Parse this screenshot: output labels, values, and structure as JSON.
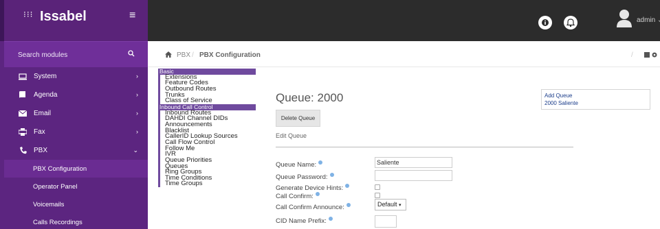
{
  "brand": {
    "name": "Issabel"
  },
  "sidebar": {
    "search_placeholder": "Search modules",
    "items": [
      {
        "label": "System",
        "icon": "monitor-icon"
      },
      {
        "label": "Agenda",
        "icon": "book-icon"
      },
      {
        "label": "Email",
        "icon": "envelope-icon"
      },
      {
        "label": "Fax",
        "icon": "printer-icon"
      },
      {
        "label": "PBX",
        "icon": "phone-icon"
      }
    ],
    "sub_items": [
      {
        "label": "PBX Configuration"
      },
      {
        "label": "Operator Panel"
      },
      {
        "label": "Voicemails"
      },
      {
        "label": "Calls Recordings"
      }
    ]
  },
  "topbar": {
    "user": "admin"
  },
  "breadcrumb": {
    "section": "PBX",
    "page": "PBX Configuration"
  },
  "module_menu": [
    {
      "label": "Basic",
      "kind": "cat"
    },
    {
      "label": "Extensions",
      "kind": "item"
    },
    {
      "label": "Feature Codes",
      "kind": "item"
    },
    {
      "label": "Outbound Routes",
      "kind": "item"
    },
    {
      "label": "Trunks",
      "kind": "item"
    },
    {
      "label": "Class of Service",
      "kind": "item"
    },
    {
      "label": "Inbound Call Control",
      "kind": "cat"
    },
    {
      "label": "Inbound Routes",
      "kind": "item"
    },
    {
      "label": "DAHDI Channel DIDs",
      "kind": "item"
    },
    {
      "label": "Announcements",
      "kind": "item"
    },
    {
      "label": "Blacklist",
      "kind": "item"
    },
    {
      "label": "CallerID Lookup Sources",
      "kind": "item"
    },
    {
      "label": "Call Flow Control",
      "kind": "item"
    },
    {
      "label": "Follow Me",
      "kind": "item"
    },
    {
      "label": "IVR",
      "kind": "item"
    },
    {
      "label": "Queue Priorities",
      "kind": "item"
    },
    {
      "label": "Queues",
      "kind": "item"
    },
    {
      "label": "Ring Groups",
      "kind": "item"
    },
    {
      "label": "Time Conditions",
      "kind": "item"
    },
    {
      "label": "Time Groups",
      "kind": "item"
    }
  ],
  "queue": {
    "title": "Queue: 2000",
    "delete_label": "Delete Queue",
    "edit_label": "Edit Queue"
  },
  "queue_list": {
    "add_label": "Add Queue",
    "entry_label": "2000 Saliente"
  },
  "form": {
    "queue_name_label": "Queue Name:",
    "queue_name_value": "Saliente",
    "queue_password_label": "Queue Password:",
    "queue_password_value": "",
    "gen_hints_label": "Generate Device Hints:",
    "call_confirm_label": "Call Confirm:",
    "call_confirm_announce_label": "Call Confirm Announce:",
    "call_confirm_announce_value": "Default",
    "cid_prefix_label": "CID Name Prefix:"
  },
  "colors": {
    "sidebar": "#5c2580",
    "topbar": "#2c2c2c",
    "menu_category": "#6f4a9e",
    "link": "#1a3c8a"
  }
}
